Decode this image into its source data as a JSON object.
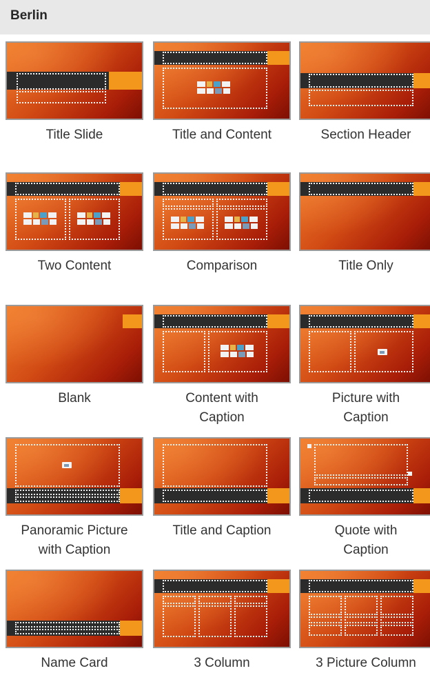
{
  "section": {
    "title": "Berlin"
  },
  "layouts": [
    {
      "line1": "Title Slide",
      "line2": ""
    },
    {
      "line1": "Title and Content",
      "line2": ""
    },
    {
      "line1": "Section Header",
      "line2": ""
    },
    {
      "line1": "Two Content",
      "line2": ""
    },
    {
      "line1": "Comparison",
      "line2": ""
    },
    {
      "line1": "Title Only",
      "line2": ""
    },
    {
      "line1": "Blank",
      "line2": ""
    },
    {
      "line1": "Content with",
      "line2": "Caption"
    },
    {
      "line1": "Picture with",
      "line2": "Caption"
    },
    {
      "line1": "Panoramic Picture",
      "line2": "with Caption"
    },
    {
      "line1": "Title and Caption",
      "line2": ""
    },
    {
      "line1": "Quote with",
      "line2": "Caption"
    },
    {
      "line1": "Name Card",
      "line2": ""
    },
    {
      "line1": "3 Column",
      "line2": ""
    },
    {
      "line1": "3 Picture Column",
      "line2": ""
    }
  ],
  "theme": {
    "bar_color": "#2b2b2b",
    "accent_color": "#f3961c",
    "gradient_start": "#ef7a2a",
    "gradient_end": "#7d0f03"
  }
}
